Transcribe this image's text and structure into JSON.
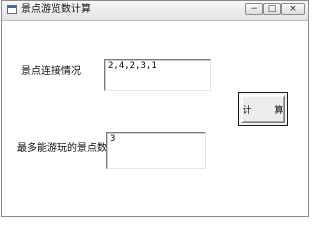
{
  "window": {
    "title": "景点游览数计算",
    "controls": {
      "minimize": "−",
      "maximize": "□",
      "close": "×"
    }
  },
  "form": {
    "connection_label": "景点连接情况",
    "connection_value": "2,4,2,3,1",
    "max_label": "最多能游玩的景点数",
    "max_value": "3",
    "compute_label": "计 算"
  },
  "icons": [
    "app-window-icon"
  ]
}
